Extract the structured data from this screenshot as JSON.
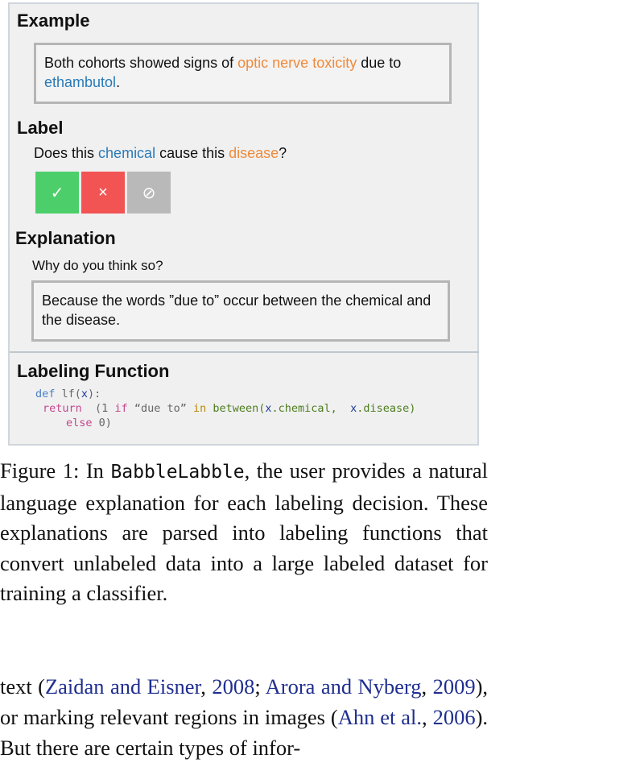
{
  "figure": {
    "example_heading": "Example",
    "example_text": {
      "part1": "Both cohorts showed signs of ",
      "disease": "optic nerve toxicity",
      "part2": " due to ",
      "chemical": "ethambutol",
      "part3": "."
    },
    "label_heading": "Label",
    "question": {
      "part1": "Does this ",
      "chemical": "chemical",
      "part2": " cause this ",
      "disease": "disease",
      "part3": "?"
    },
    "buttons": {
      "accept_symbol": "✓",
      "reject_symbol": "×",
      "skip_symbol": "⊘"
    },
    "explanation_heading": "Explanation",
    "why_prompt": "Why do you think so?",
    "explanation_text": "Because the words ”due to” occur between the chemical and the disease.",
    "lf_heading": "Labeling Function",
    "code": {
      "def": "def",
      "fname": " lf(",
      "x": "x",
      "close": "):",
      "return": "return",
      "open": "  (1 ",
      "if": "if",
      "str": " “due to” ",
      "in": "in",
      "between": " between(",
      "x1": "x",
      "chem": ".chemical,  ",
      "x2": "x",
      "dis": ".disease)",
      "else": "else",
      "zero": " 0)"
    }
  },
  "caption": {
    "prefix": "Figure 1:  In ",
    "system": "BabbleLabble",
    "rest": ", the user provides a natural language explanation for each labeling decision. These explanations are parsed into labeling functions that convert unlabeled data into a large labeled dataset for training a classifier."
  },
  "body": {
    "t1": "text (",
    "c1": "Zaidan and Eisner",
    "t2": ", ",
    "c2": "2008",
    "t3": "; ",
    "c3": "Arora and Nyberg",
    "t4": ", ",
    "c4": "2009",
    "t5": "), or marking relevant regions in images (",
    "c5": "Ahn et al.",
    "t6": ", ",
    "c6": "2006",
    "t7": "). But there are certain types of infor-"
  },
  "colors": {
    "chemical": "#2a7ab8",
    "disease": "#f08a3a",
    "accept": "#4ccf6a",
    "reject": "#f25454",
    "skip": "#b9b9b9",
    "citation": "#1f2e8f"
  }
}
